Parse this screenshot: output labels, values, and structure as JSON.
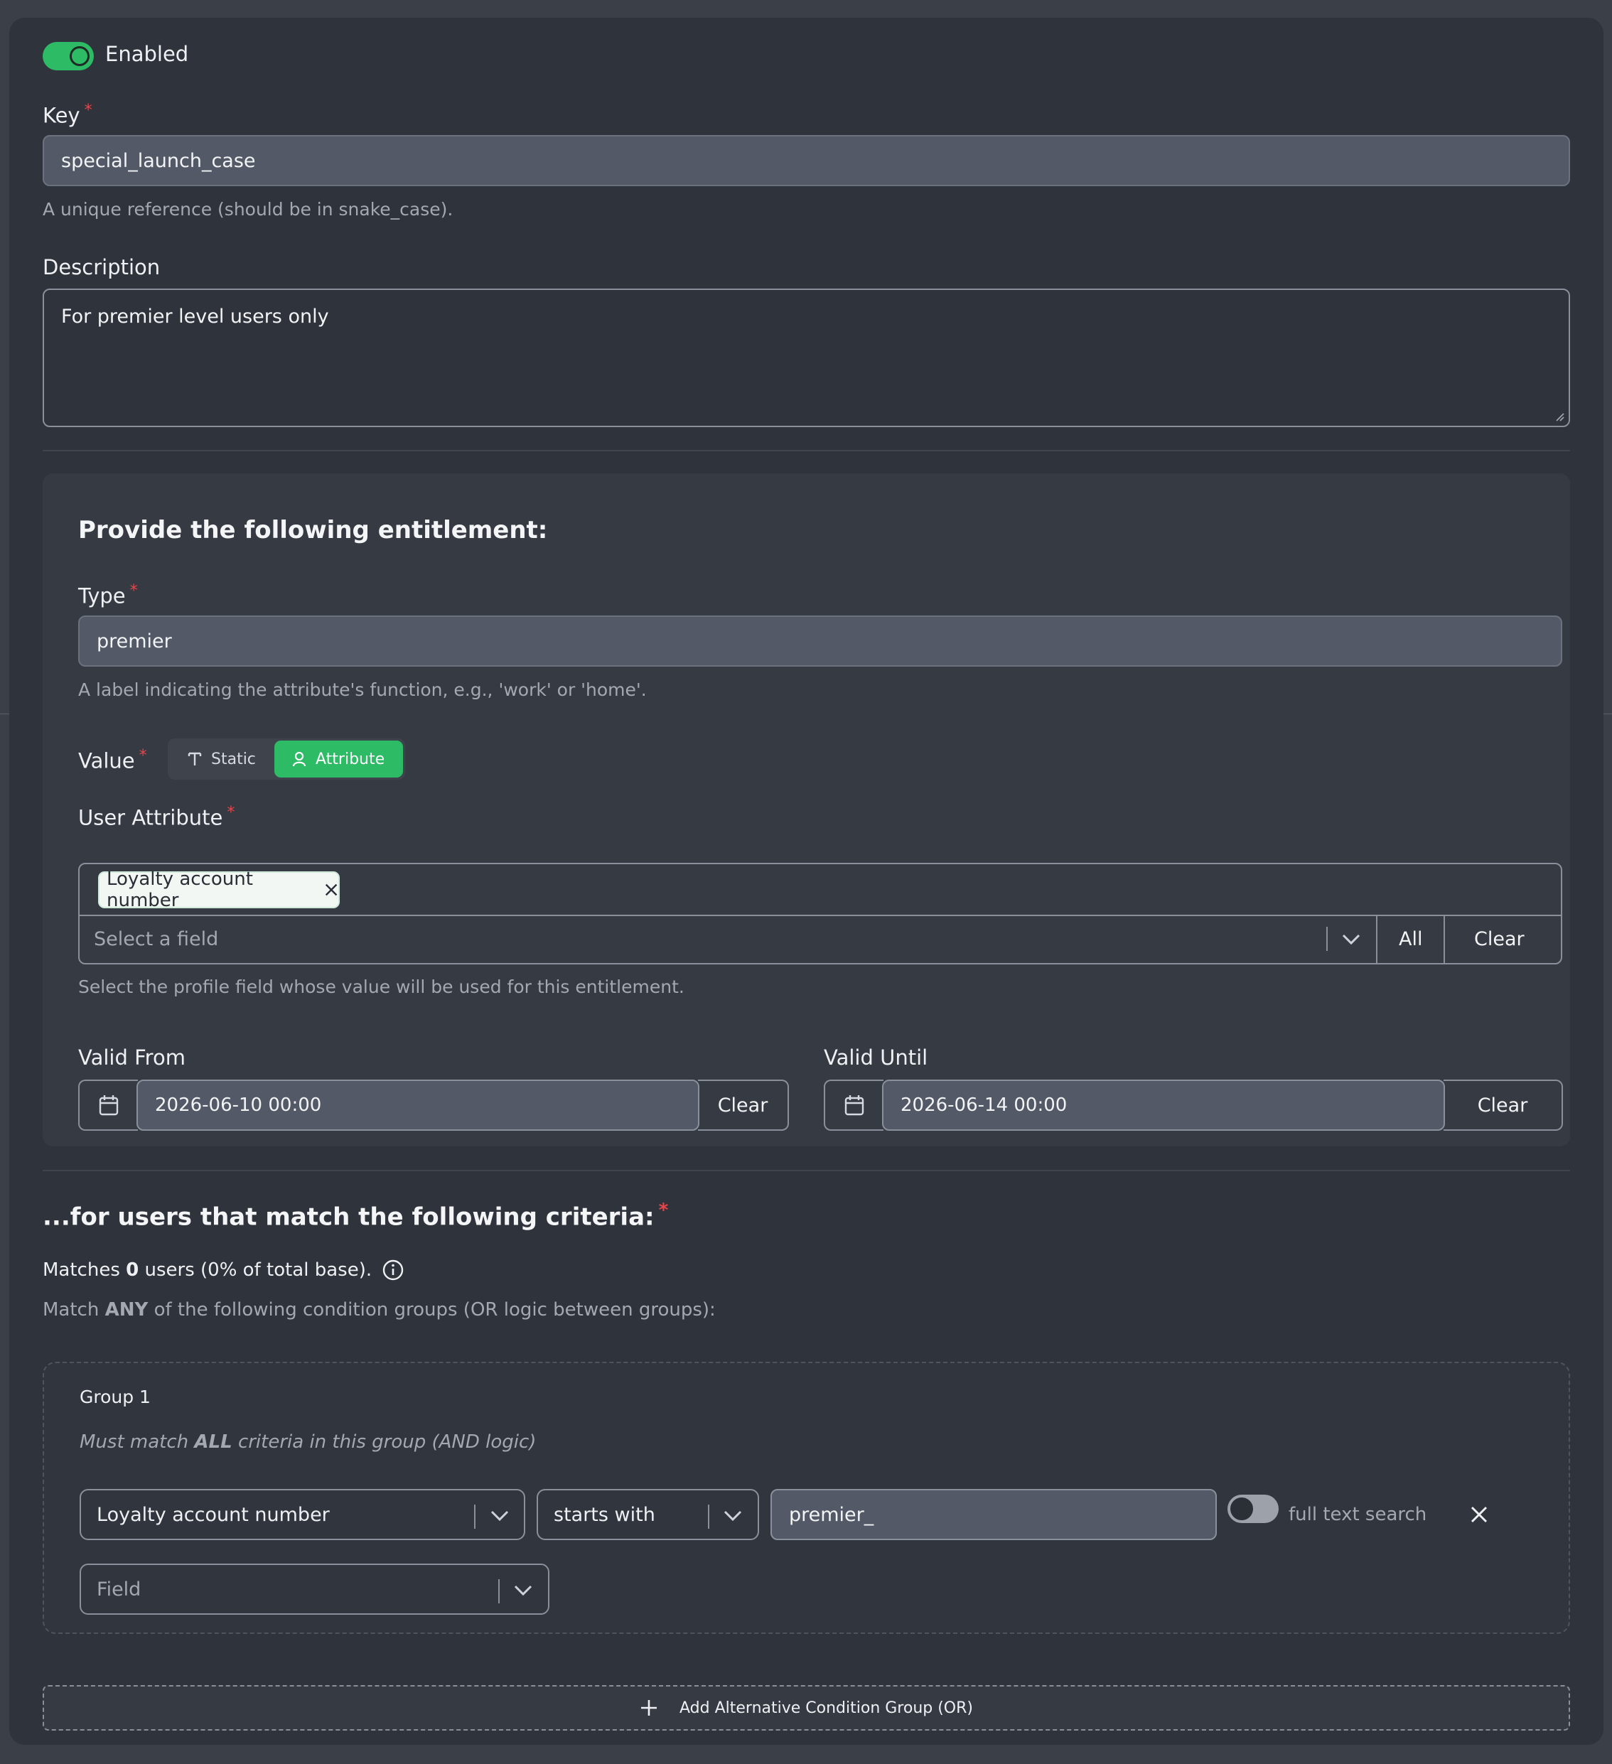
{
  "form": {
    "enabled_label": "Enabled",
    "enabled": true,
    "key": {
      "label": "Key",
      "required_mark": "*",
      "value": "special_launch_case",
      "hint": "A unique reference (should be in snake_case)."
    },
    "description": {
      "label": "Description",
      "value": "For premier level users only"
    }
  },
  "entitlement": {
    "heading": "Provide the following entitlement:",
    "type": {
      "label": "Type",
      "required_mark": "*",
      "value": "premier",
      "hint": "A label indicating the attribute's function, e.g., 'work' or 'home'."
    },
    "value": {
      "label": "Value",
      "required_mark": "*",
      "options": [
        "Static",
        "Attribute"
      ],
      "selected": "Attribute"
    },
    "user_attribute": {
      "label": "User Attribute",
      "required_mark": "*",
      "chip": "Loyalty account number",
      "placeholder": "Select a field",
      "all_label": "All",
      "clear_label": "Clear",
      "hint": "Select the profile field whose value will be used for this entitlement."
    },
    "valid_from": {
      "label": "Valid From",
      "value": "2026-06-10 00:00",
      "clear_label": "Clear"
    },
    "valid_until": {
      "label": "Valid Until",
      "value": "2026-06-14 00:00",
      "clear_label": "Clear"
    }
  },
  "criteria": {
    "heading": "...for users that match the following criteria:",
    "required_mark": "*",
    "matches_prefix": "Matches ",
    "matches_count": "0",
    "matches_suffix": " users (0% of total base).",
    "match_prefix": "Match ",
    "match_keyword": "ANY",
    "match_suffix": " of the following condition groups (OR logic between groups):",
    "groups": [
      {
        "title": "Group 1",
        "logic_prefix": "Must match ",
        "logic_keyword": "ALL",
        "logic_suffix": " criteria in this group (AND logic)",
        "condition": {
          "field": "Loyalty account number",
          "operator": "starts with",
          "value": "premier_",
          "full_text_search_label": "full text search",
          "full_text_search": false
        },
        "new_field_placeholder": "Field"
      }
    ],
    "add_group_label": "Add Alternative Condition Group (OR)"
  },
  "colors": {
    "accent_green": "#2dbb65",
    "required_red": "#e8454b",
    "panel": "#2f333b",
    "background": "#3b3f48"
  },
  "icons": [
    "text-icon",
    "user-icon",
    "close-icon",
    "chevron-down-icon",
    "calendar-icon",
    "info-icon",
    "plus-icon"
  ]
}
